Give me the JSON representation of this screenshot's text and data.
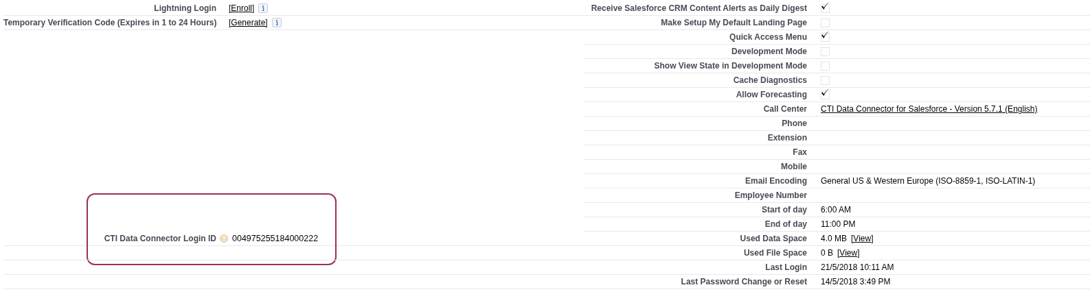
{
  "left_rows": [
    {
      "kind": "link",
      "label": "Lightning Login",
      "link": "[Enroll]",
      "info": true
    },
    {
      "kind": "link",
      "label": "Temporary Verification Code (Expires in 1 to 24 Hours)",
      "link": "[Generate]",
      "info": true
    },
    {
      "kind": "id",
      "label": "CTI Data Connector Login ID",
      "value": "004975255184000222",
      "help": true,
      "highlighted": true
    }
  ],
  "right_rows": [
    {
      "kind": "checkbox",
      "label": "Receive Salesforce CRM Content Alerts as Daily Digest",
      "checked": true
    },
    {
      "kind": "checkbox",
      "label": "Make Setup My Default Landing Page",
      "checked": false
    },
    {
      "kind": "checkbox",
      "label": "Quick Access Menu",
      "checked": true
    },
    {
      "kind": "checkbox",
      "label": "Development Mode",
      "checked": false
    },
    {
      "kind": "checkbox",
      "label": "Show View State in Development Mode",
      "checked": false
    },
    {
      "kind": "checkbox",
      "label": "Cache Diagnostics",
      "checked": false
    },
    {
      "kind": "checkbox",
      "label": "Allow Forecasting",
      "checked": true
    },
    {
      "kind": "link",
      "label": "Call Center",
      "link": "CTI Data Connector for Salesforce - Version 5.7.1 (English)"
    },
    {
      "kind": "text",
      "label": "Phone"
    },
    {
      "kind": "text",
      "label": "Extension"
    },
    {
      "kind": "text",
      "label": "Fax"
    },
    {
      "kind": "text",
      "label": "Mobile"
    },
    {
      "kind": "text",
      "label": "Email Encoding",
      "value": "General US & Western Europe (ISO-8859-1, ISO-LATIN-1)"
    },
    {
      "kind": "text",
      "label": "Employee Number"
    },
    {
      "kind": "text",
      "label": "Start of day",
      "value": "6:00 AM"
    },
    {
      "kind": "text",
      "label": "End of day",
      "value": "11:00 PM"
    },
    {
      "kind": "size",
      "label": "Used Data Space",
      "value": "4.0 MB",
      "link": "[View]"
    },
    {
      "kind": "size",
      "label": "Used File Space",
      "value": "0 B",
      "link": "[View]"
    },
    {
      "kind": "text",
      "label": "Last Login",
      "value": "21/5/2018 10:11 AM"
    },
    {
      "kind": "text",
      "label": "Last Password Change or Reset",
      "value": "14/5/2018 3:49 PM"
    }
  ]
}
